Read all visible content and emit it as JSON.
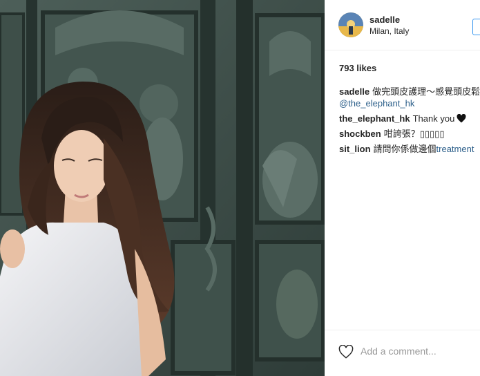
{
  "post": {
    "photo_icon": "post-photo",
    "username": "sadelle",
    "location": "Milan, Italy",
    "likes": "793 likes",
    "comments": [
      {
        "user": "sadelle",
        "text": "做完頭皮護理～感覺頭皮鬆",
        "mention": "@the_elephant_hk"
      },
      {
        "user": "the_elephant_hk",
        "text": "Thank you",
        "icon": "black-heart-icon"
      },
      {
        "user": "shockben",
        "text": "咁誇張？",
        "tofu": "▯▯▯▯▯"
      },
      {
        "user": "sit_lion",
        "text": "請問你係做邊個",
        "tail": "treatment"
      }
    ],
    "comment_placeholder": "Add a comment...",
    "colors": {
      "mention": "#2c5f8a",
      "follow_border": "#3897f0",
      "separator": "#efefef"
    }
  }
}
